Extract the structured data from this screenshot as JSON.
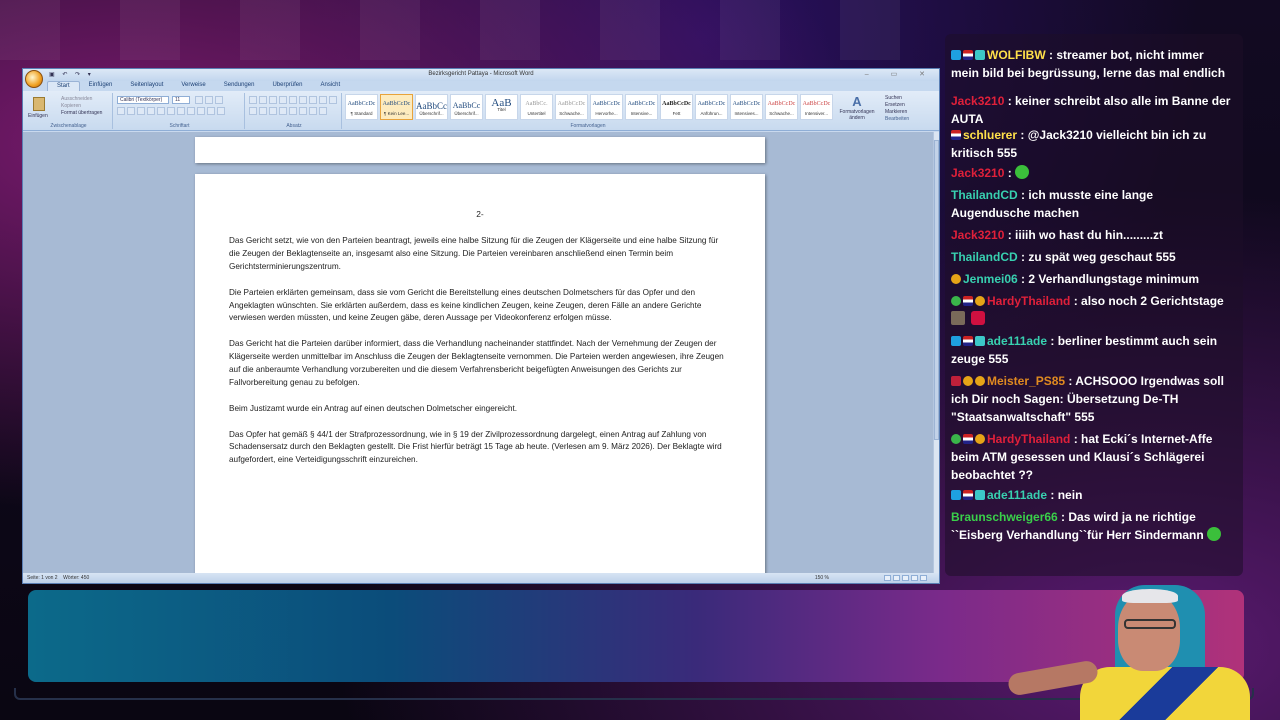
{
  "word": {
    "window_title": "Bezirksgericht Pattaya - Microsoft Word",
    "tabs": [
      "Start",
      "Einfügen",
      "Seitenlayout",
      "Verweise",
      "Sendungen",
      "Überprüfen",
      "Ansicht"
    ],
    "ribbon": {
      "clipboard": {
        "paste": "Einfügen",
        "cut": "Ausschneiden",
        "copy": "Kopieren",
        "format": "Format übertragen",
        "label": "Zwischenablage"
      },
      "font": {
        "name": "Calibri (Textkörper)",
        "size": "11",
        "label": "Schriftart"
      },
      "paragraph_label": "Absatz",
      "styles": [
        {
          "sample": "AaBbCcDc",
          "name": "¶ Standard"
        },
        {
          "sample": "AaBbCcDc",
          "name": "¶ Kein Lee..."
        },
        {
          "sample": "AaBbCc",
          "name": "Überschrif..."
        },
        {
          "sample": "AaBbCc",
          "name": "Überschrif..."
        },
        {
          "sample": "AaB",
          "name": "Titel"
        },
        {
          "sample": "AaBbCc.",
          "name": "Untertitel"
        },
        {
          "sample": "AaBbCcDc",
          "name": "Schwache..."
        },
        {
          "sample": "AaBbCcDc",
          "name": "Hervorhe..."
        },
        {
          "sample": "AaBbCcDc",
          "name": "Intensive..."
        },
        {
          "sample": "AaBbCcDc",
          "name": "Fett"
        },
        {
          "sample": "AaBbCcDc",
          "name": "Anführun..."
        },
        {
          "sample": "AaBbCcDc",
          "name": "Intensives..."
        },
        {
          "sample": "AaBbCcDc",
          "name": "Schwache..."
        },
        {
          "sample": "AaBbCcDc",
          "name": "Intensiver..."
        }
      ],
      "styles_label": "Formatvorlagen",
      "change_styles": "Formatvorlagen ändern",
      "editing": {
        "find": "Suchen",
        "replace": "Ersetzen",
        "select": "Markieren",
        "label": "Bearbeiten"
      }
    },
    "page": {
      "number": "2-",
      "paragraphs": [
        "Das Gericht setzt, wie von den Parteien beantragt, jeweils eine halbe Sitzung für die Zeugen der Klägerseite und eine halbe Sitzung für die Zeugen der Beklagtenseite an, insgesamt also eine Sitzung. Die Parteien vereinbaren anschließend einen Termin beim Gerichtsterminierungszentrum.",
        "Die Parteien erklärten gemeinsam, dass sie vom Gericht die Bereitstellung eines deutschen Dolmetschers für das Opfer und den Angeklagten wünschten. Sie erklärten außerdem, dass es keine kindlichen Zeugen, keine Zeugen, deren Fälle an andere Gerichte verwiesen werden müssten, und keine Zeugen gäbe, deren Aussage per Videokonferenz erfolgen müsse.",
        "Das Gericht hat die Parteien darüber informiert, dass die Verhandlung nacheinander stattfindet. Nach der Vernehmung der Zeugen der Klägerseite werden unmittelbar im Anschluss die Zeugen der Beklagtenseite vernommen. Die Parteien werden angewiesen, ihre Zeugen auf die anberaumte Verhandlung vorzubereiten und die diesem Verfahrensbericht beigefügten Anweisungen des Gerichts zur Fallvorbereitung genau zu befolgen.",
        "Beim Justizamt wurde ein Antrag auf einen deutschen Dolmetscher eingereicht.",
        "Das Opfer hat gemäß § 44/1 der Strafprozessordnung, wie in § 19 der Zivilprozessordnung dargelegt, einen Antrag auf Zahlung von Schadensersatz durch den Beklagten gestellt. Die Frist hierfür beträgt 15 Tage ab heute. (Verlesen am 9. März 2026). Der Beklagte wird aufgefordert, eine Verteidigungsschrift einzureichen."
      ]
    },
    "status": {
      "page": "Seite: 1 von 2",
      "words": "Wörter: 450",
      "zoom": "150 %"
    }
  },
  "chat": [
    {
      "user": "WOLFIBW",
      "color": "#ffe04a",
      "badges": [
        "b-blue",
        "b-flag",
        "b-cyan"
      ],
      "text": ": streamer bot, nicht immer mein bild bei begrüssung, lerne das mal endlich"
    },
    {
      "user": "Jack3210",
      "color": "#e0203a",
      "badges": [],
      "text": ": keiner schreibt also alle im Banne der AUTA"
    },
    {
      "user": "schluerer",
      "color": "#ffe04a",
      "badges": [
        "b-flag"
      ],
      "text": ": @Jack3210 vielleicht bin ich zu kritisch 555"
    },
    {
      "user": "Jack3210",
      "color": "#e0203a",
      "badges": [],
      "text": ":"
    },
    {
      "user": "ThailandCD",
      "color": "#38d0b0",
      "badges": [],
      "text": ": ich musste eine lange Augendusche machen"
    },
    {
      "user": "Jack3210",
      "color": "#e0203a",
      "badges": [],
      "text": ": iiiih wo hast du hin.........zt"
    },
    {
      "user": "ThailandCD",
      "color": "#38d0b0",
      "badges": [],
      "text": ": zu spät weg geschaut 555"
    },
    {
      "user": "Jenmei06",
      "color": "#38d0b0",
      "badges": [
        "b-gold"
      ],
      "text": ": 2 Verhandlungstage minimum"
    },
    {
      "user": "HardyThailand",
      "color": "#e0203a",
      "badges": [
        "b-green",
        "b-flag",
        "b-gold"
      ],
      "text": ": also noch 2 Gerichtstage"
    },
    {
      "user": "ade111ade",
      "color": "#38d0b0",
      "badges": [
        "b-blue",
        "b-flag",
        "b-cyan"
      ],
      "text": ": berliner bestimmt auch sein zeuge 555"
    },
    {
      "user": "Meister_PS85",
      "color": "#e08a20",
      "badges": [
        "b-red",
        "b-gold",
        "b-gold"
      ],
      "text": ": ACHSOOO Irgendwas soll ich Dir noch Sagen: Übersetzung De-TH \"Staatsanwaltschaft\" 555"
    },
    {
      "user": "HardyThailand",
      "color": "#e0203a",
      "badges": [
        "b-green",
        "b-flag",
        "b-gold"
      ],
      "text": ": hat Ecki´s Internet-Affe beim ATM gesessen und Klausi´s Schlägerei beobachtet ??"
    },
    {
      "user": "ade111ade",
      "color": "#38d0b0",
      "badges": [
        "b-blue",
        "b-flag",
        "b-cyan"
      ],
      "text": ": nein"
    },
    {
      "user": "Braunschweiger66",
      "color": "#3ad04a",
      "badges": [],
      "text": ": Das wird ja ne richtige ``Eisberg Verhandlung``für Herr Sindermann"
    }
  ]
}
